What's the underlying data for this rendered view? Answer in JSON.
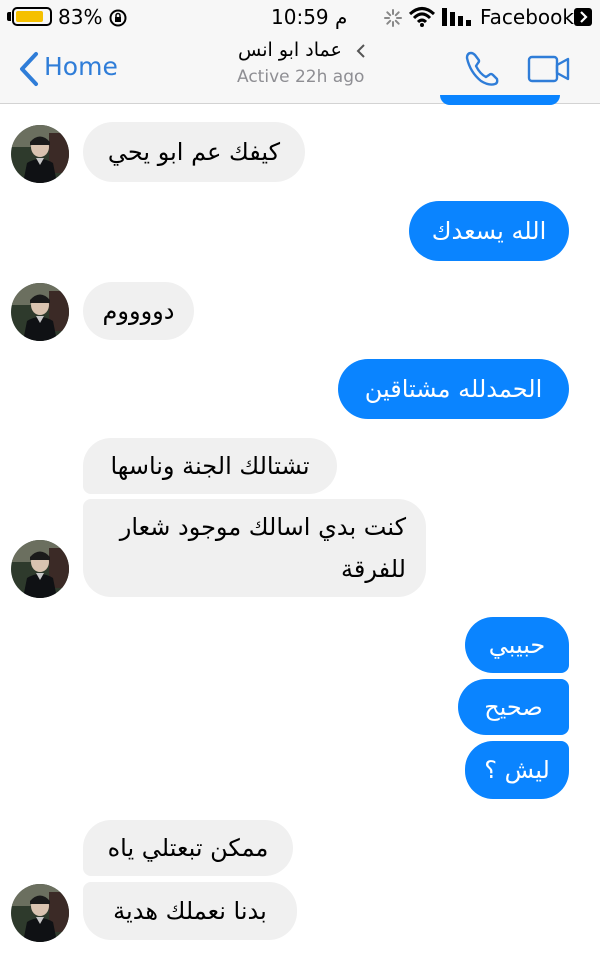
{
  "status_bar": {
    "battery": "83%",
    "battery_level": 0.83,
    "time": "10:59 م",
    "carrier": "Facebook"
  },
  "header": {
    "back_label": "Home",
    "contact_name": "عماد ابو انس",
    "contact_status": "Active 22h ago"
  },
  "messages": [
    {
      "direction": "incoming",
      "text": "كيفك عم ابو يحي"
    },
    {
      "direction": "outgoing",
      "text": "الله يسعدك"
    },
    {
      "direction": "incoming",
      "text": "دووووم"
    },
    {
      "direction": "outgoing",
      "text": "الحمدلله مشتاقين"
    },
    {
      "direction": "incoming",
      "text": "تشتالك الجنة وناسها"
    },
    {
      "direction": "incoming",
      "text": "كنت بدي اسالك موجود شعار",
      "text2": "للفرقة"
    },
    {
      "direction": "outgoing",
      "text": "حبيبي"
    },
    {
      "direction": "outgoing",
      "text": "صحيح"
    },
    {
      "direction": "outgoing",
      "text": "ليش ؟"
    },
    {
      "direction": "incoming",
      "text": "ممكن تبعتلي ياه"
    },
    {
      "direction": "incoming",
      "text": "بدنا نعملك هدية"
    }
  ],
  "colors": {
    "accent": "#2f7dd8",
    "outgoing_bubble": "#0a84ff",
    "incoming_bubble": "#f0f0f0",
    "battery": "#f5c000"
  },
  "icons": {
    "back": "chevron-left-icon",
    "call": "phone-icon",
    "video": "video-camera-icon",
    "wifi": "wifi-icon",
    "signal": "signal-bars-icon"
  }
}
